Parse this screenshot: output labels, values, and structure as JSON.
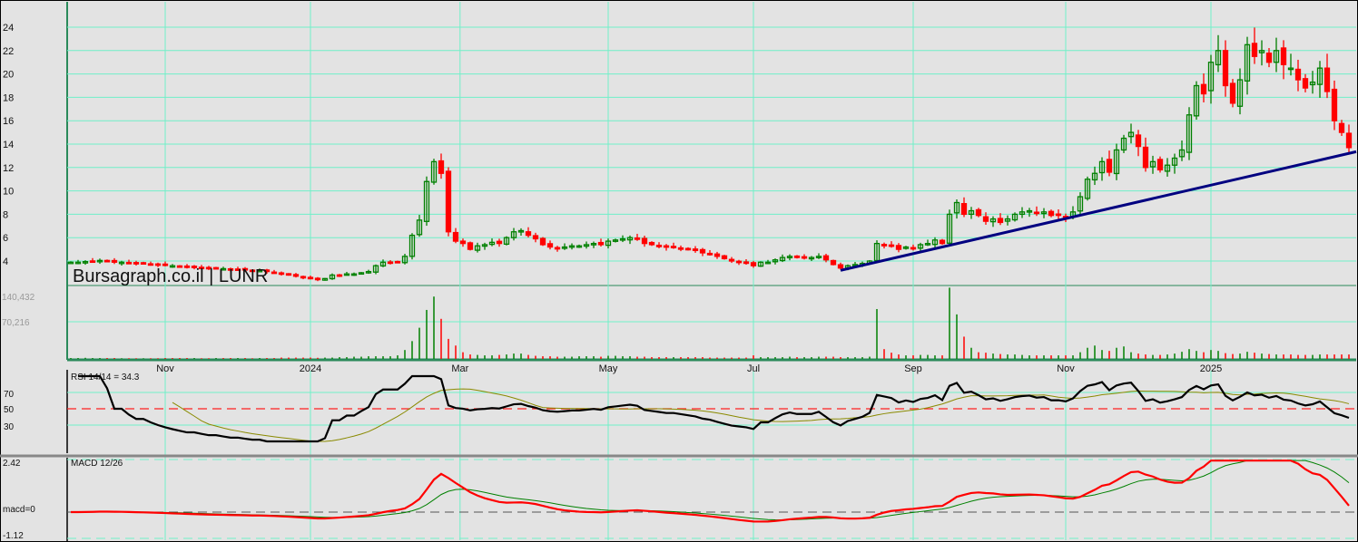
{
  "title": "Bursagraph.co.il | LUNR",
  "colors": {
    "up": "#008000",
    "down": "#ff0000",
    "grid": "#70f0c8",
    "trend": "#000080",
    "rsi": "#000000",
    "rsi_avg": "#8a8a00",
    "macd": "#ff0000",
    "signal": "#008000"
  },
  "chart_data": {
    "type": "candlestick",
    "ticker": "LUNR",
    "price_ticks": [
      "4",
      "6",
      "8",
      "10",
      "12",
      "14",
      "16",
      "18",
      "20",
      "22",
      "24"
    ],
    "ylim": [
      1.9,
      26.3
    ],
    "x_ticks": [
      {
        "label": "Nov",
        "index": 13
      },
      {
        "label": "2024",
        "index": 33
      },
      {
        "label": "Mar",
        "index": 53.6
      },
      {
        "label": "May",
        "index": 74
      },
      {
        "label": "Jul",
        "index": 94
      },
      {
        "label": "Sep",
        "index": 116
      },
      {
        "label": "Nov",
        "index": 137
      },
      {
        "label": "2025",
        "index": 157
      }
    ],
    "close": [
      3.9,
      3.9,
      3.95,
      4.0,
      4.05,
      4.0,
      3.9,
      3.9,
      3.85,
      3.8,
      3.8,
      3.75,
      3.7,
      3.65,
      3.6,
      3.55,
      3.5,
      3.5,
      3.45,
      3.4,
      3.4,
      3.35,
      3.3,
      3.3,
      3.25,
      3.2,
      3.2,
      3.1,
      3.0,
      2.9,
      2.8,
      2.7,
      2.6,
      2.5,
      2.4,
      2.5,
      2.8,
      2.8,
      2.9,
      2.9,
      3.0,
      3.1,
      3.6,
      3.9,
      3.9,
      3.9,
      4.4,
      6.2,
      7.5,
      10.8,
      12.5,
      11.5,
      6.5,
      5.7,
      5.5,
      5.0,
      5.3,
      5.4,
      5.6,
      5.5,
      6.0,
      6.5,
      6.6,
      6.2,
      5.9,
      5.4,
      5.2,
      5.1,
      5.2,
      5.3,
      5.3,
      5.4,
      5.5,
      5.4,
      5.7,
      5.8,
      5.9,
      6.0,
      5.9,
      5.5,
      5.4,
      5.3,
      5.2,
      5.2,
      5.1,
      5.0,
      4.9,
      4.7,
      4.6,
      4.4,
      4.2,
      4.0,
      3.9,
      3.8,
      3.6,
      3.9,
      3.9,
      4.1,
      4.3,
      4.4,
      4.3,
      4.3,
      4.3,
      4.4,
      4.1,
      3.7,
      3.4,
      3.6,
      3.7,
      3.8,
      4.0,
      5.5,
      5.4,
      5.3,
      5.0,
      5.2,
      5.1,
      5.4,
      5.5,
      5.8,
      5.5,
      8.0,
      9.0,
      8.0,
      8.3,
      7.9,
      7.4,
      7.6,
      7.3,
      7.6,
      8.0,
      8.2,
      8.3,
      8.1,
      8.2,
      7.9,
      7.9,
      7.8,
      8.2,
      9.5,
      11.0,
      11.5,
      12.5,
      11.6,
      13.5,
      14.5,
      15.0,
      13.8,
      12.0,
      12.5,
      11.8,
      12.2,
      12.8,
      13.5,
      16.5,
      19.0,
      18.3,
      21.0,
      22.0,
      19.0,
      17.5,
      19.5,
      22.5,
      21.5,
      22.0,
      21.0,
      22.0,
      20.8,
      20.5,
      19.5,
      18.8,
      19.3,
      20.5,
      18.5,
      16.0,
      15.0,
      13.7
    ],
    "volume": [
      2000,
      2000,
      2500,
      2000,
      2000,
      2000,
      2000,
      1500,
      1500,
      1500,
      1500,
      1500,
      1500,
      2000,
      2000,
      2000,
      2000,
      2000,
      1500,
      1500,
      2000,
      2000,
      2000,
      2000,
      2000,
      1500,
      2000,
      2000,
      2000,
      3000,
      3000,
      3000,
      3000,
      3000,
      2500,
      3000,
      3000,
      4000,
      4000,
      5000,
      5000,
      6000,
      6000,
      6000,
      6000,
      8000,
      20000,
      40000,
      70000,
      110000,
      140000,
      90000,
      45000,
      30000,
      15000,
      10000,
      9000,
      8000,
      8000,
      9000,
      10000,
      12000,
      12000,
      9000,
      7000,
      6000,
      6000,
      5000,
      5000,
      5000,
      6000,
      6000,
      6000,
      5000,
      7000,
      7000,
      6000,
      6000,
      5000,
      5000,
      4000,
      4000,
      4000,
      4000,
      4000,
      4000,
      4000,
      4000,
      3000,
      3000,
      3000,
      3000,
      3000,
      3000,
      8000,
      4000,
      4000,
      4000,
      4000,
      5000,
      4000,
      4000,
      4000,
      5000,
      5000,
      5000,
      4000,
      4000,
      4000,
      4000,
      5000,
      112000,
      22000,
      14000,
      10000,
      8000,
      8000,
      9000,
      9000,
      8000,
      8000,
      160000,
      100000,
      50000,
      25000,
      15000,
      14000,
      12000,
      11000,
      10000,
      10000,
      9000,
      8000,
      8000,
      8000,
      8000,
      8000,
      8000,
      8000,
      15000,
      25000,
      30000,
      20000,
      18000,
      25000,
      28000,
      15000,
      12000,
      10000,
      9000,
      9000,
      10000,
      12000,
      16000,
      22000,
      18000,
      15000,
      20000,
      18000,
      13000,
      11000,
      12000,
      16000,
      14000,
      12000,
      11000,
      10000,
      10000,
      10000,
      9000,
      9000,
      9000,
      10000,
      10000,
      10000,
      10000,
      10000
    ],
    "volume_ticks": [
      "140,432",
      "70,216"
    ],
    "volume_max": 140432,
    "trendline": {
      "from": {
        "index": 106,
        "price": 3.2
      },
      "to": {
        "index": 177,
        "price": 13.35
      }
    },
    "rsi": {
      "label": "RSI 14/14 = 34.3",
      "period": 14,
      "avg_period": 14,
      "ticks": [
        "70",
        "50",
        "30"
      ],
      "levels": [
        70,
        50,
        30
      ]
    },
    "macd": {
      "label": "MACD 12/26",
      "fast": 12,
      "slow": 26,
      "signal": 9,
      "ticks": {
        "max": "2.42",
        "zero": "macd=0",
        "min": "-1.12"
      },
      "ylim": [
        -1.12,
        2.42
      ]
    }
  }
}
